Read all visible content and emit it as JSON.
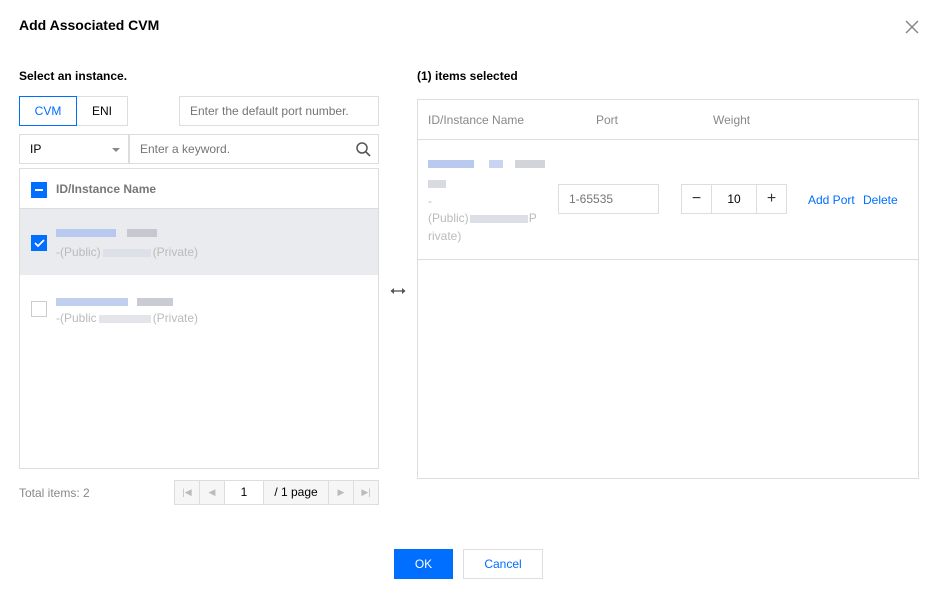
{
  "dialog": {
    "title": "Add Associated CVM",
    "close_icon": "close-icon"
  },
  "left": {
    "section_label": "Select an instance.",
    "tabs": [
      {
        "label": "CVM",
        "active": true
      },
      {
        "label": "ENI",
        "active": false
      }
    ],
    "port_input": {
      "placeholder": "Enter the default port number.",
      "value": ""
    },
    "filter_select": {
      "value": "IP"
    },
    "keyword_input": {
      "placeholder": "Enter a keyword.",
      "value": ""
    },
    "table": {
      "header": "ID/Instance Name",
      "rows": [
        {
          "checked": true,
          "line2_prefix": "-(Public)",
          "line2_suffix": "(Private)"
        },
        {
          "checked": false,
          "line2_prefix": "-(Public",
          "line2_suffix": "(Private)"
        }
      ]
    },
    "footer": {
      "total_label": "Total items:",
      "total_count": "2",
      "page_value": "1",
      "page_total": "/ 1 page"
    }
  },
  "transfer_icon": "left-right-arrow-icon",
  "right": {
    "section_label": "(1) items selected",
    "columns": {
      "name": "ID/Instance Name",
      "port": "Port",
      "weight": "Weight"
    },
    "row": {
      "dash": "-",
      "public_label": "(Public)",
      "private_frag_1": "P",
      "private_frag_2": "rivate)",
      "port_placeholder": "1-65535",
      "weight_value": "10",
      "minus_label": "−",
      "plus_label": "+",
      "add_port_label": "Add Port",
      "delete_label": "Delete"
    }
  },
  "footer": {
    "ok_label": "OK",
    "cancel_label": "Cancel"
  },
  "colors": {
    "primary": "#006eff",
    "border": "#dddddd",
    "selected_row_bg": "#e9ebee"
  }
}
